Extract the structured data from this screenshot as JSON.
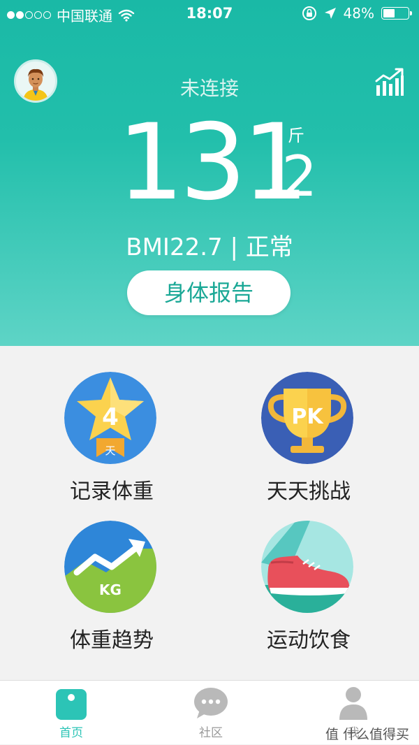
{
  "status_bar": {
    "carrier": "中国联通",
    "time": "18:07",
    "battery_percent": "48%",
    "battery_level": 0.48,
    "signal_bars_filled": 2,
    "signal_bars_total": 5
  },
  "header": {
    "connection_status": "未连接",
    "avatar_icon": "user-avatar",
    "trend_icon": "bar-chart-trend-icon"
  },
  "weight": {
    "integer": "131",
    "decimal": ".2",
    "unit": "斤"
  },
  "bmi_text": "BMI22.7 | 正常",
  "report_button": "身体报告",
  "tiles": [
    {
      "label": "记录体重",
      "icon": "star-streak-icon",
      "badge_number": "4",
      "badge_unit": "天",
      "bg": "#3b8ee0"
    },
    {
      "label": "天天挑战",
      "icon": "trophy-pk-icon",
      "badge_text": "PK",
      "bg": "#3a5fb5"
    },
    {
      "label": "体重趋势",
      "icon": "trend-arrow-kg-icon",
      "badge_text": "KG",
      "bg": "#2e86d8"
    },
    {
      "label": "运动饮食",
      "icon": "sneaker-icon",
      "bg": "#9ee4e0"
    }
  ],
  "tabbar": {
    "home": "首页",
    "community": "社区",
    "me": "我",
    "active": "home"
  },
  "watermark": "值 什么值得买",
  "colors": {
    "accent": "#2cc4b6",
    "hero_top": "#1ab9a6",
    "hero_bottom": "#5ed4c6"
  }
}
